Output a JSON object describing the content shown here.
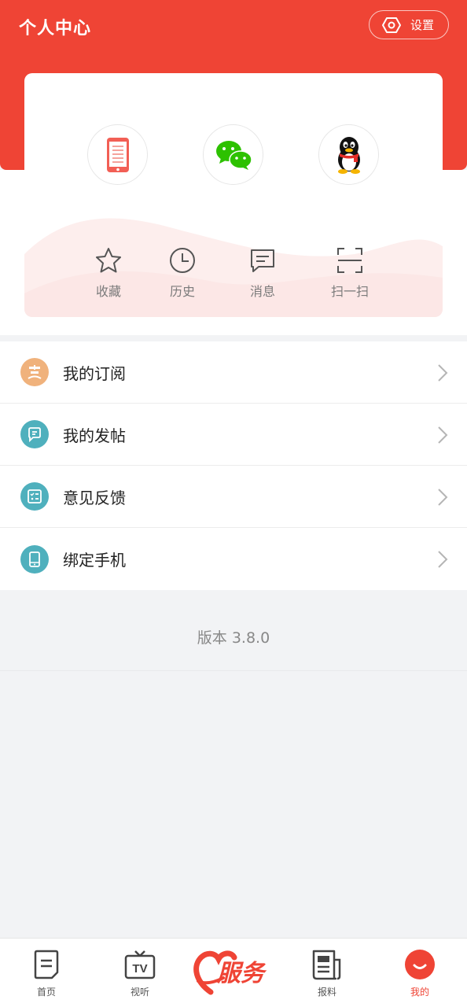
{
  "header": {
    "title": "个人中心",
    "settings_label": "设置",
    "settings_icon": "gear-icon"
  },
  "login_options": [
    {
      "name": "phone-login",
      "icon": "phone-icon"
    },
    {
      "name": "wechat-login",
      "icon": "wechat-icon"
    },
    {
      "name": "qq-login",
      "icon": "qq-penguin-icon"
    }
  ],
  "quick_actions": [
    {
      "label": "收藏",
      "icon": "star-icon"
    },
    {
      "label": "历史",
      "icon": "clock-icon"
    },
    {
      "label": "消息",
      "icon": "message-icon"
    },
    {
      "label": "扫一扫",
      "icon": "scan-icon"
    }
  ],
  "menu": [
    {
      "label": "我的订阅",
      "icon": "subscribe-icon",
      "color": "#f0b27c"
    },
    {
      "label": "我的发帖",
      "icon": "post-icon",
      "color": "#4fb0bd"
    },
    {
      "label": "意见反馈",
      "icon": "feedback-icon",
      "color": "#4fb0bd"
    },
    {
      "label": "绑定手机",
      "icon": "bind-phone-icon",
      "color": "#4fb0bd"
    }
  ],
  "version": "版本 3.8.0",
  "tabbar": {
    "items": [
      {
        "label": "首页",
        "icon": "home-doc-icon"
      },
      {
        "label": "视听",
        "icon": "tv-icon"
      },
      {
        "label": "服务",
        "icon": "service-heart-logo"
      },
      {
        "label": "报料",
        "icon": "news-report-icon"
      },
      {
        "label": "我的",
        "icon": "mine-smile-icon"
      }
    ],
    "active": "我的"
  },
  "colors": {
    "brand_red": "#ef4435",
    "teal_icon": "#4fb0bd",
    "orange_icon": "#f0b27c"
  }
}
